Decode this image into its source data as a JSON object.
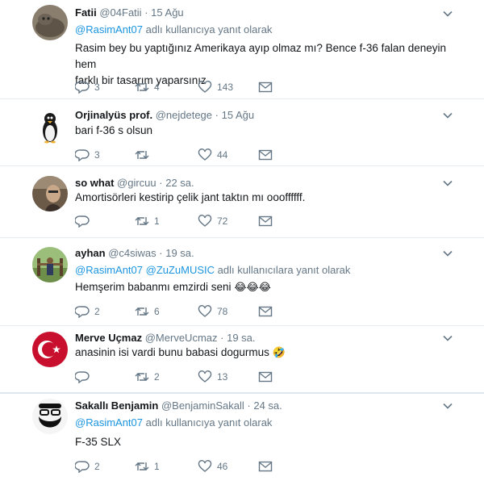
{
  "tweets": [
    {
      "name": "Fatii",
      "handle": "@04Fatii",
      "time": "15 Ağu",
      "reply_mentions": "@RasimAnt07",
      "reply_suffix": " adlı kullanıcıya yanıt olarak",
      "text_lines": [
        "Rasim bey bu yaptığınız Amerikaya ayıp olmaz mı? Bence f-36 falan deneyin hem",
        "farklı bir tasarım yaparsınız"
      ],
      "replies": "3",
      "retweets": "4",
      "likes": "143"
    },
    {
      "name": "Orjinalyüs prof.",
      "handle": "@nejdetege",
      "time": "15 Ağu",
      "text_lines": [
        "bari f-36 s olsun"
      ],
      "replies": "3",
      "retweets": "",
      "likes": "44"
    },
    {
      "name": "so what",
      "handle": "@gircuu",
      "time": "22 sa.",
      "text_lines": [
        "Amortisörleri kestirip çelik jant taktın mı oooffffff."
      ],
      "replies": "",
      "retweets": "1",
      "likes": "72"
    },
    {
      "name": "ayhan",
      "handle": "@c4siwas",
      "time": "19 sa.",
      "reply_mentions": "@RasimAnt07 @ZuZuMUSIC",
      "reply_suffix": " adlı kullanıcılara yanıt olarak",
      "text_lines": [
        "Hemşerim babanmı emzirdi seni"
      ],
      "emoji_after": "😂😂😂",
      "replies": "2",
      "retweets": "6",
      "likes": "78"
    },
    {
      "name": "Merve Uçmaz",
      "handle": "@MerveUcmaz",
      "time": "19 sa.",
      "text_lines": [
        "anasinin isi vardi bunu babasi dogurmus"
      ],
      "emoji_after": "🤣",
      "replies": "",
      "retweets": "2",
      "likes": "13"
    },
    {
      "name": "Sakallı Benjamin",
      "handle": "@BenjaminSakall",
      "time": "24 sa.",
      "reply_mentions": "@RasimAnt07",
      "reply_suffix": " adlı kullanıcıya yanıt olarak",
      "text_lines": [
        "F-35 SLX"
      ],
      "replies": "2",
      "retweets": "1",
      "likes": "46"
    }
  ],
  "colors": {
    "accent": "#1b95e0",
    "muted": "#657786",
    "text": "#14171a"
  },
  "icons": [
    "reply-icon",
    "retweet-icon",
    "like-icon",
    "dm-icon",
    "chevron-down-icon"
  ]
}
